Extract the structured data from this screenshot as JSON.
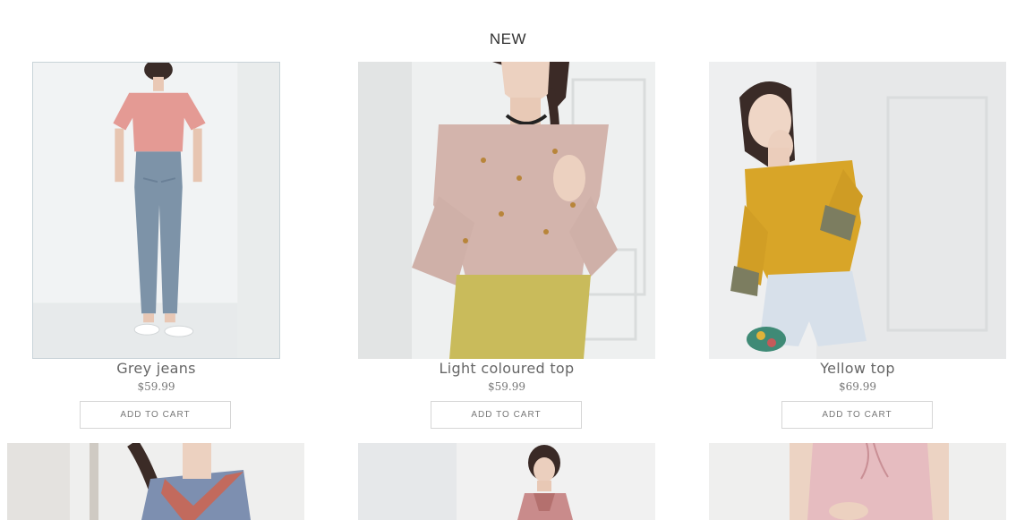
{
  "section": {
    "title": "NEW"
  },
  "products": [
    {
      "name": "Grey jeans",
      "price": "$59.99",
      "button_label": "ADD TO CART"
    },
    {
      "name": "Light coloured top",
      "price": "$59.99",
      "button_label": "ADD TO CART"
    },
    {
      "name": "Yellow top",
      "price": "$69.99",
      "button_label": "ADD TO CART"
    }
  ],
  "colors": {
    "background": "#ffffff",
    "text": "#333333",
    "muted_text": "#777777",
    "button_border": "#d6d6d6"
  }
}
